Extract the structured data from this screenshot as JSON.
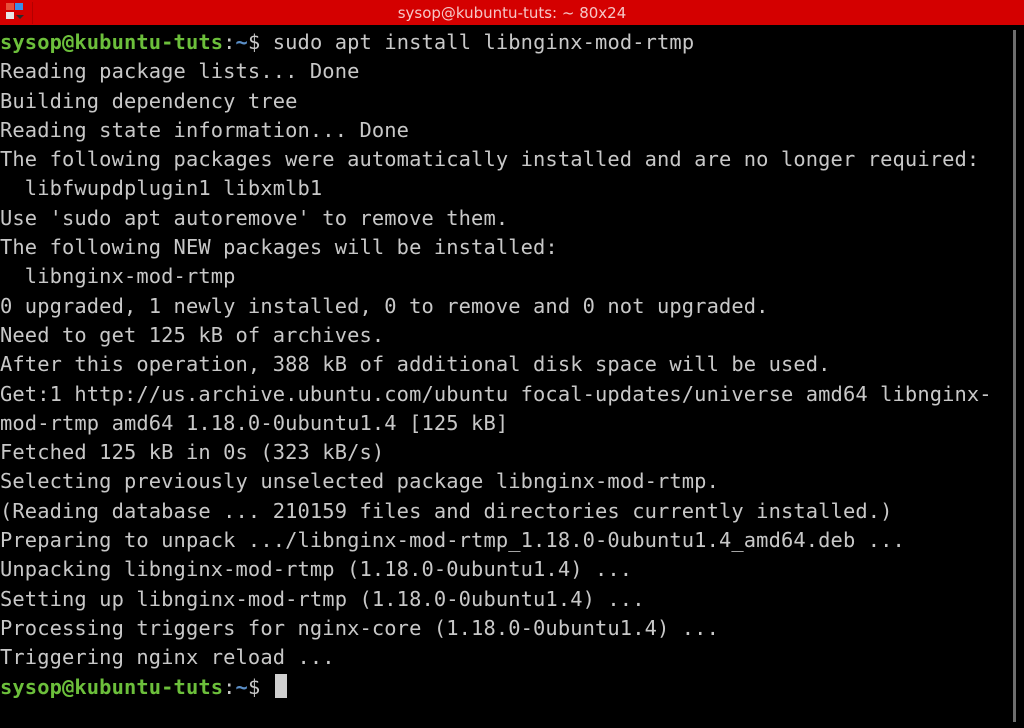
{
  "window": {
    "title": "sysop@kubuntu-tuts: ~ 80x24",
    "app_icon": "konsole-app-icon"
  },
  "prompt": {
    "user_host": "sysop@kubuntu-tuts",
    "colon": ":",
    "dir": "~",
    "dollar": "$ "
  },
  "colors": {
    "titlebar": "#d40000",
    "prompt_user": "#6cbf3b",
    "prompt_dir": "#5a8ec6",
    "text": "#c8c8c8",
    "background": "#000000"
  },
  "command": "sudo apt install libnginx-mod-rtmp",
  "output": [
    "Reading package lists... Done",
    "Building dependency tree",
    "Reading state information... Done",
    "The following packages were automatically installed and are no longer required:",
    "  libfwupdplugin1 libxmlb1",
    "Use 'sudo apt autoremove' to remove them.",
    "The following NEW packages will be installed:",
    "  libnginx-mod-rtmp",
    "0 upgraded, 1 newly installed, 0 to remove and 0 not upgraded.",
    "Need to get 125 kB of archives.",
    "After this operation, 388 kB of additional disk space will be used.",
    "Get:1 http://us.archive.ubuntu.com/ubuntu focal-updates/universe amd64 libnginx-",
    "mod-rtmp amd64 1.18.0-0ubuntu1.4 [125 kB]",
    "Fetched 125 kB in 0s (323 kB/s)",
    "Selecting previously unselected package libnginx-mod-rtmp.",
    "(Reading database ... 210159 files and directories currently installed.)",
    "Preparing to unpack .../libnginx-mod-rtmp_1.18.0-0ubuntu1.4_amd64.deb ...",
    "Unpacking libnginx-mod-rtmp (1.18.0-0ubuntu1.4) ...",
    "Setting up libnginx-mod-rtmp (1.18.0-0ubuntu1.4) ...",
    "Processing triggers for nginx-core (1.18.0-0ubuntu1.4) ...",
    "Triggering nginx reload ..."
  ]
}
